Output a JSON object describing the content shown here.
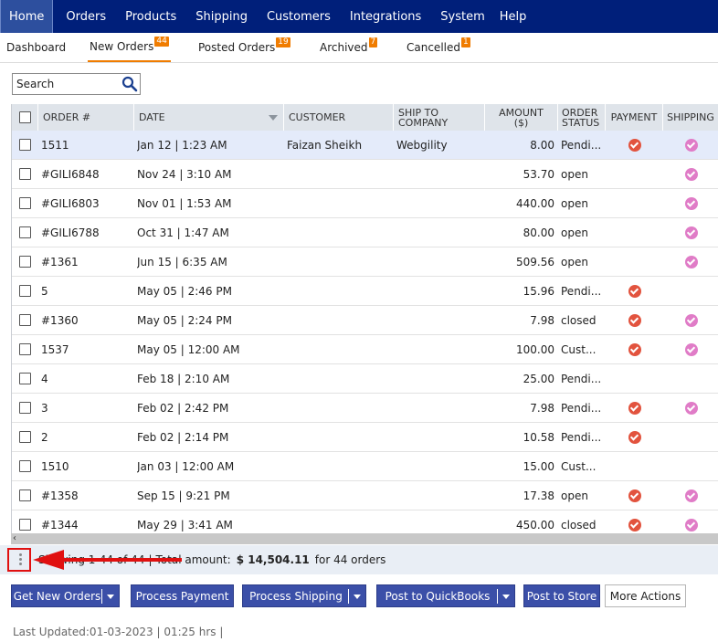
{
  "nav": {
    "items": [
      {
        "label": "Home",
        "active": true
      },
      {
        "label": "Orders"
      },
      {
        "label": "Products"
      },
      {
        "label": "Shipping"
      },
      {
        "label": "Customers"
      },
      {
        "label": "Integrations"
      },
      {
        "label": "System"
      },
      {
        "label": "Help"
      }
    ]
  },
  "tabs": {
    "dashboard": {
      "label": "Dashboard"
    },
    "new_orders": {
      "label": "New Orders",
      "count": "44"
    },
    "posted_orders": {
      "label": "Posted Orders",
      "count": "19"
    },
    "archived": {
      "label": "Archived",
      "count": "7"
    },
    "cancelled": {
      "label": "Cancelled",
      "count": "1"
    }
  },
  "search": {
    "placeholder": "Search"
  },
  "grid": {
    "headers": {
      "order": "ORDER #",
      "date": "DATE",
      "customer": "CUSTOMER",
      "ship_to_1": "SHIP TO",
      "ship_to_2": "COMPANY",
      "amount_1": "AMOUNT",
      "amount_2": "($)",
      "status_1": "ORDER",
      "status_2": "STATUS",
      "payment": "PAYMENT",
      "shipping": "SHIPPING"
    },
    "rows": [
      {
        "order": "1511",
        "date": "Jan 12 | 1:23 AM",
        "customer": "Faizan Sheikh",
        "company": "Webgility",
        "amount": "8.00",
        "status": "Pendi...",
        "payment": true,
        "shipping": true,
        "selected": true
      },
      {
        "order": "#GILI6848",
        "date": "Nov 24 | 3:10 AM",
        "customer": "",
        "company": "",
        "amount": "53.70",
        "status": "open",
        "payment": false,
        "shipping": true
      },
      {
        "order": "#GILI6803",
        "date": "Nov 01 | 1:53 AM",
        "customer": "",
        "company": "",
        "amount": "440.00",
        "status": "open",
        "payment": false,
        "shipping": true
      },
      {
        "order": "#GILI6788",
        "date": "Oct 31 | 1:47 AM",
        "customer": "",
        "company": "",
        "amount": "80.00",
        "status": "open",
        "payment": false,
        "shipping": true
      },
      {
        "order": "#1361",
        "date": "Jun 15 | 6:35 AM",
        "customer": "",
        "company": "",
        "amount": "509.56",
        "status": "open",
        "payment": false,
        "shipping": true
      },
      {
        "order": "5",
        "date": "May 05 | 2:46 PM",
        "customer": "",
        "company": "",
        "amount": "15.96",
        "status": "Pendi...",
        "payment": true,
        "shipping": false
      },
      {
        "order": "#1360",
        "date": "May 05 | 2:24 PM",
        "customer": "",
        "company": "",
        "amount": "7.98",
        "status": "closed",
        "payment": true,
        "shipping": true
      },
      {
        "order": "1537",
        "date": "May 05 | 12:00 AM",
        "customer": "",
        "company": "",
        "amount": "100.00",
        "status": "Cust...",
        "payment": true,
        "shipping": true
      },
      {
        "order": "4",
        "date": "Feb 18 | 2:10 AM",
        "customer": "",
        "company": "",
        "amount": "25.00",
        "status": "Pendi...",
        "payment": false,
        "shipping": false
      },
      {
        "order": "3",
        "date": "Feb 02 | 2:42 PM",
        "customer": "",
        "company": "",
        "amount": "7.98",
        "status": "Pendi...",
        "payment": true,
        "shipping": true
      },
      {
        "order": "2",
        "date": "Feb 02 | 2:14 PM",
        "customer": "",
        "company": "",
        "amount": "10.58",
        "status": "Pendi...",
        "payment": true,
        "shipping": false
      },
      {
        "order": "1510",
        "date": "Jan 03 | 12:00 AM",
        "customer": "",
        "company": "",
        "amount": "15.00",
        "status": "Cust...",
        "payment": false,
        "shipping": false
      },
      {
        "order": "#1358",
        "date": "Sep 15 | 9:21 PM",
        "customer": "",
        "company": "",
        "amount": "17.38",
        "status": "open",
        "payment": true,
        "shipping": true
      },
      {
        "order": "#1344",
        "date": "May 29 | 3:41 AM",
        "customer": "",
        "company": "",
        "amount": "450.00",
        "status": "closed",
        "payment": true,
        "shipping": true
      }
    ]
  },
  "summary": {
    "showing": "Showing 1-44 of 44",
    "total_label": "Total amount:",
    "total_value": "$ 14,504.11",
    "for_orders": "for 44 orders"
  },
  "actions": {
    "get_new_orders": "Get New Orders",
    "process_payment": "Process Payment",
    "process_shipping": "Process Shipping",
    "post_quickbooks": "Post to QuickBooks",
    "post_store": "Post to Store",
    "more_actions": "More Actions"
  },
  "footer": {
    "last_updated": "Last Updated:01-03-2023 | 01:25 hrs |"
  },
  "colors": {
    "nav_bg": "#001f7a",
    "accent": "#f07c00",
    "button": "#3b4fa8",
    "payment_icon": "#e2533e",
    "shipping_icon": "#e07cc7"
  }
}
